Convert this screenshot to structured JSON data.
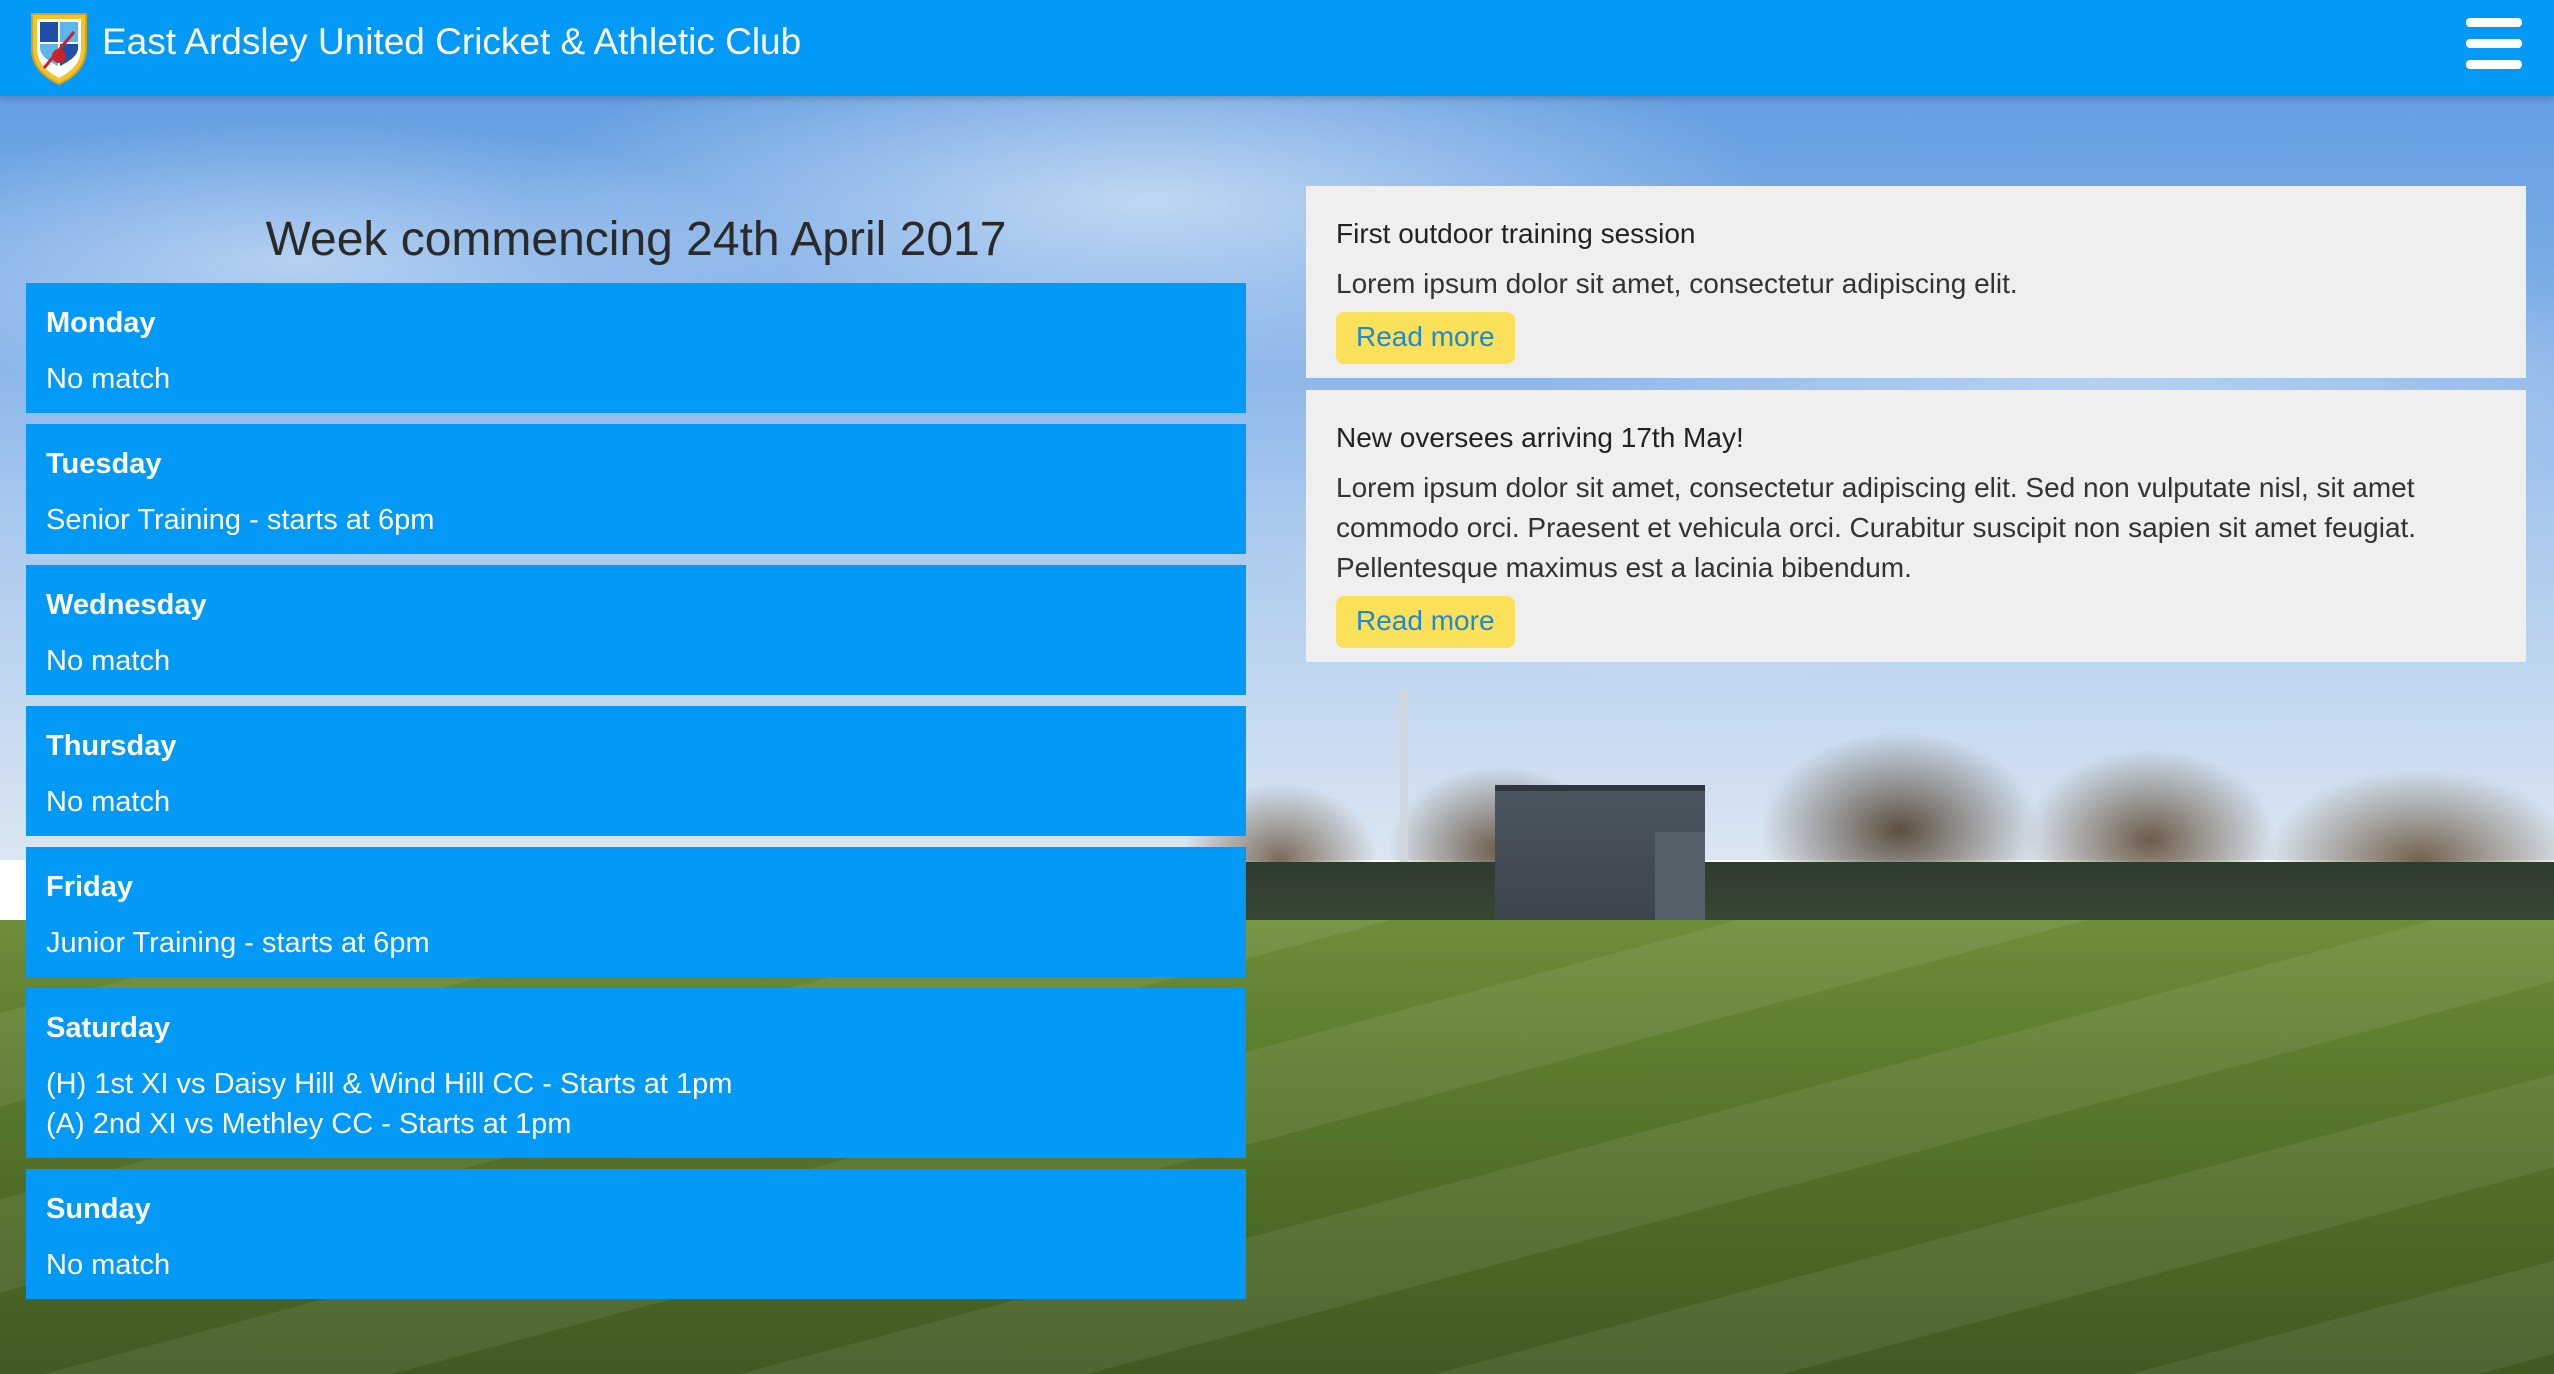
{
  "header": {
    "site_title": "East Ardsley United Cricket & Athletic Club",
    "logo_icon": "club-crest-icon",
    "menu_icon": "hamburger-menu-icon",
    "background_color": "#0399f7"
  },
  "schedule": {
    "title": "Week commencing 24th April 2017",
    "days": [
      {
        "name": "Monday",
        "events": [
          "No match"
        ]
      },
      {
        "name": "Tuesday",
        "events": [
          "Senior Training - starts at 6pm"
        ]
      },
      {
        "name": "Wednesday",
        "events": [
          "No match"
        ]
      },
      {
        "name": "Thursday",
        "events": [
          "No match"
        ]
      },
      {
        "name": "Friday",
        "events": [
          "Junior Training - starts at 6pm"
        ]
      },
      {
        "name": "Saturday",
        "events": [
          "(H) 1st XI vs Daisy Hill & Wind Hill CC - Starts at 1pm",
          "(A) 2nd XI vs Methley CC - Starts at 1pm"
        ]
      },
      {
        "name": "Sunday",
        "events": [
          "No match"
        ]
      }
    ],
    "card_color": "#0399f7"
  },
  "news": {
    "items": [
      {
        "title": "First outdoor training session",
        "body": "Lorem ipsum dolor sit amet, consectetur adipiscing elit.",
        "button_label": "Read more"
      },
      {
        "title": "New oversees arriving 17th May!",
        "body": "Lorem ipsum dolor sit amet, consectetur adipiscing elit. Sed non vulputate nisl, sit amet commodo orci. Praesent et vehicula orci. Curabitur suscipit non sapien sit amet feugiat. Pellentesque maximus est a lacinia bibendum.",
        "button_label": "Read more"
      }
    ],
    "button_color": "#fbe05a",
    "card_color": "#efefef"
  }
}
